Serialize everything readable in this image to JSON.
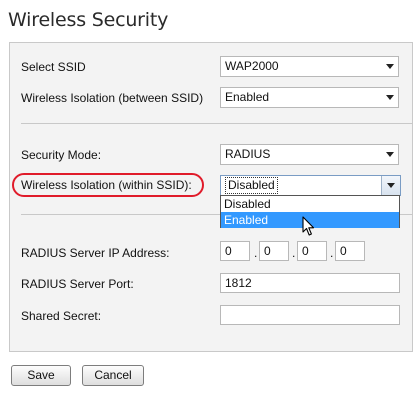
{
  "page": {
    "title": "Wireless Security"
  },
  "form": {
    "select_ssid": {
      "label": "Select SSID",
      "value": "WAP2000"
    },
    "isolation_between": {
      "label": "Wireless Isolation (between SSID)",
      "value": "Enabled"
    },
    "security_mode": {
      "label": "Security Mode:",
      "value": "RADIUS"
    },
    "isolation_within": {
      "label": "Wireless Isolation (within SSID):",
      "value": "Disabled",
      "options": [
        "Disabled",
        "Enabled"
      ],
      "hovered_option": "Enabled"
    },
    "radius_ip": {
      "label": "RADIUS Server IP Address:",
      "octets": [
        "0",
        "0",
        "0",
        "0"
      ],
      "separator": "."
    },
    "radius_port": {
      "label": "RADIUS Server Port:",
      "value": "1812"
    },
    "shared_secret": {
      "label": "Shared Secret:",
      "value": ""
    }
  },
  "buttons": {
    "save": "Save",
    "cancel": "Cancel"
  },
  "colors": {
    "highlight_oval": "#e01b2a",
    "selected_option": "#3399ff",
    "panel_bg": "#f3f3f3"
  }
}
